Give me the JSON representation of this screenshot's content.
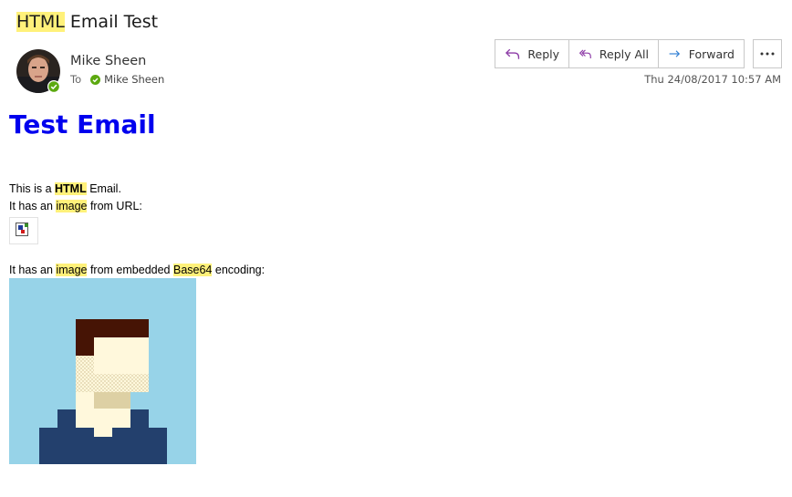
{
  "window": {
    "subject_highlight": "HTML",
    "subject_rest": " Email Test"
  },
  "sender": {
    "name": "Mike Sheen",
    "to_label": "To",
    "recipient": "Mike Sheen",
    "presence": "online"
  },
  "actions": {
    "reply": "Reply",
    "reply_all": "Reply All",
    "forward": "Forward",
    "more": "..."
  },
  "date": "Thu 24/08/2017 10:57 AM",
  "email": {
    "heading": "Test Email",
    "line1": {
      "a": "This is a ",
      "b": "HTML",
      "c": " Email."
    },
    "line2": {
      "a": "It has an ",
      "b": "image",
      "c": " from URL:"
    },
    "line3": {
      "a": "It has an ",
      "b": "image",
      "c": " from embedded ",
      "d": "Base64",
      "e": " encoding:"
    }
  },
  "colors": {
    "heading": "#0000ee",
    "search_highlight": "#fff17a",
    "presence_green": "#5ca910",
    "reply_icon": "#8d3ca7",
    "forward_icon": "#2b7cd3",
    "pixel_bg": "#97d3e8",
    "pixel_hair": "#461405",
    "pixel_skin": "#fff8dc",
    "pixel_shirt": "#23406d"
  },
  "icons": {
    "reply": "reply-arrow-icon",
    "reply_all": "reply-all-arrow-icon",
    "forward": "forward-arrow-icon",
    "more": "ellipsis-icon",
    "presence": "presence-available-icon",
    "broken_image": "broken-image-icon"
  }
}
